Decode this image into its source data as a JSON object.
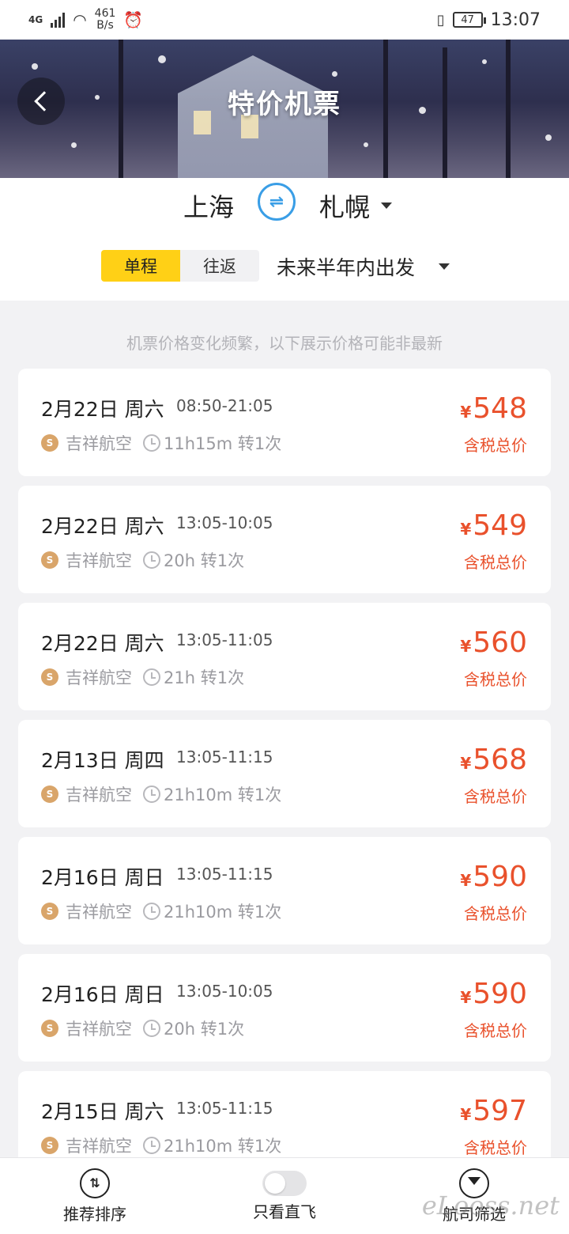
{
  "status_bar": {
    "network": "4G",
    "speed": "461",
    "speed_unit": "B/s",
    "battery": "47",
    "time": "13:07"
  },
  "header": {
    "title": "特价机票",
    "back_icon": "chevron-left-icon"
  },
  "route": {
    "from": "上海",
    "to": "札幌",
    "swap_icon": "swap-arrows-icon",
    "swap_color": "#3a9ee6"
  },
  "trip_type": {
    "one_way": "单程",
    "round_trip": "往返",
    "selected": "单程"
  },
  "date_range": "未来半年内出发",
  "notice": "机票价格变化频繁，以下展示价格可能非最新",
  "colors": {
    "accent_yellow": "#ffd016",
    "price_red": "#e9512c"
  },
  "flights": [
    {
      "date": "2月22日 周六",
      "time": "08:50-21:05",
      "airline": "吉祥航空",
      "duration": "11h15m 转1次",
      "currency": "¥",
      "price": "548",
      "tax_label": "含税总价"
    },
    {
      "date": "2月22日 周六",
      "time": "13:05-10:05",
      "airline": "吉祥航空",
      "duration": "20h 转1次",
      "currency": "¥",
      "price": "549",
      "tax_label": "含税总价"
    },
    {
      "date": "2月22日 周六",
      "time": "13:05-11:05",
      "airline": "吉祥航空",
      "duration": "21h 转1次",
      "currency": "¥",
      "price": "560",
      "tax_label": "含税总价"
    },
    {
      "date": "2月13日 周四",
      "time": "13:05-11:15",
      "airline": "吉祥航空",
      "duration": "21h10m 转1次",
      "currency": "¥",
      "price": "568",
      "tax_label": "含税总价"
    },
    {
      "date": "2月16日 周日",
      "time": "13:05-11:15",
      "airline": "吉祥航空",
      "duration": "21h10m 转1次",
      "currency": "¥",
      "price": "590",
      "tax_label": "含税总价"
    },
    {
      "date": "2月16日 周日",
      "time": "13:05-10:05",
      "airline": "吉祥航空",
      "duration": "20h 转1次",
      "currency": "¥",
      "price": "590",
      "tax_label": "含税总价"
    },
    {
      "date": "2月15日 周六",
      "time": "13:05-11:15",
      "airline": "吉祥航空",
      "duration": "21h10m 转1次",
      "currency": "¥",
      "price": "597",
      "tax_label": "含税总价"
    }
  ],
  "bottom_bar": {
    "sort_label": "推荐排序",
    "direct_label": "只看直飞",
    "filter_label": "航司筛选"
  },
  "watermark": "eLooss.net"
}
